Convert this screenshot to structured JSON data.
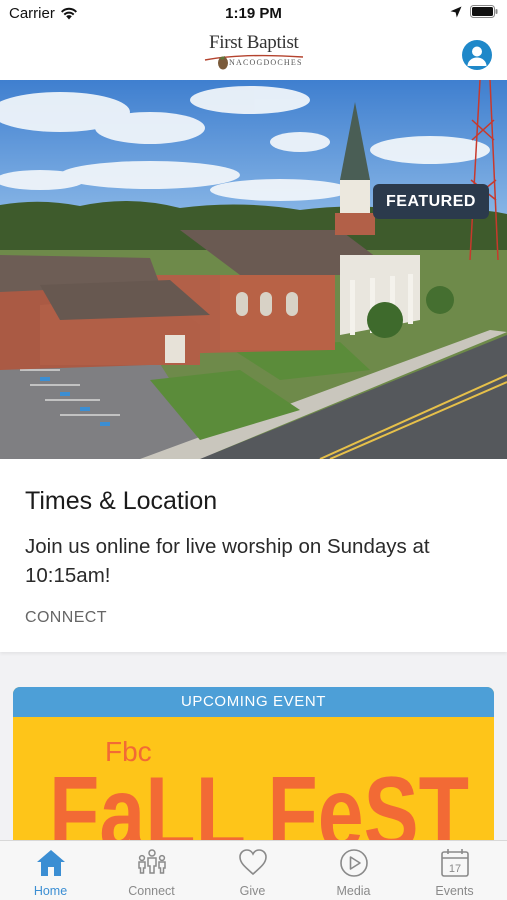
{
  "status_bar": {
    "carrier": "Carrier",
    "time": "1:19 PM"
  },
  "header": {
    "logo_line1": "First Baptist",
    "logo_line2": "NACOGDOCHES"
  },
  "hero": {
    "badge": "FEATURED"
  },
  "card": {
    "title": "Times & Location",
    "description": "Join us online for live worship on Sundays at 10:15am!",
    "link": "CONNECT"
  },
  "event": {
    "header": "UPCOMING EVENT",
    "banner_small": "Fbc",
    "banner_large": "FaLL FeST"
  },
  "tabs": [
    {
      "label": "Home",
      "icon": "home-icon",
      "active": true
    },
    {
      "label": "Connect",
      "icon": "people-icon",
      "active": false
    },
    {
      "label": "Give",
      "icon": "heart-icon",
      "active": false
    },
    {
      "label": "Media",
      "icon": "play-icon",
      "active": false
    },
    {
      "label": "Events",
      "icon": "calendar-icon",
      "active": false
    }
  ],
  "calendar_day": "17",
  "colors": {
    "accent": "#3b8ed3",
    "badge": "#2b3a4c",
    "event_header": "#4d9fd7",
    "event_bg": "#fec519",
    "event_text": "#f26a35"
  }
}
